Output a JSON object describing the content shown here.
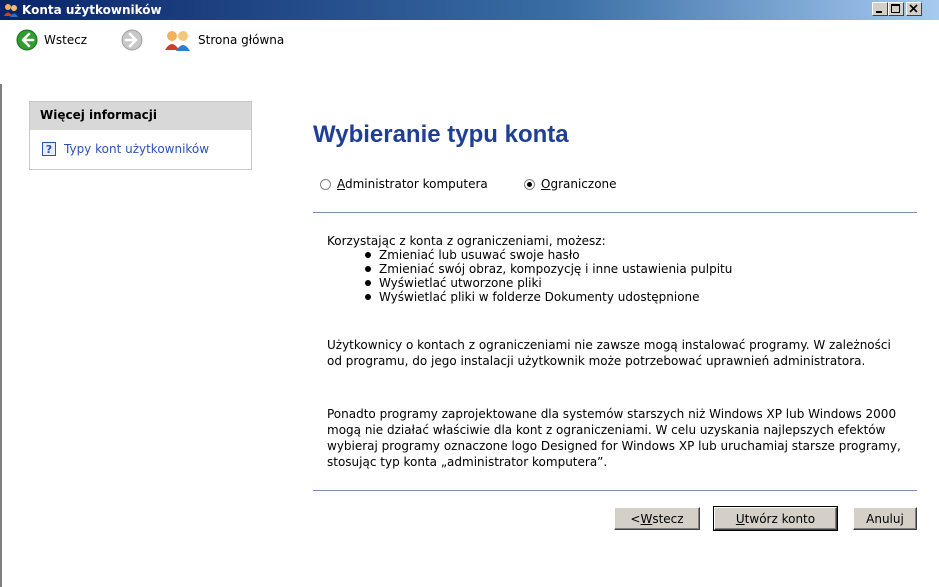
{
  "window": {
    "title": "Konta użytkowników",
    "icon": "users-icon"
  },
  "navbar": {
    "back_label": "Wstecz",
    "home_label": "Strona główna"
  },
  "sidebar": {
    "heading": "Więcej informacji",
    "link_label": "Typy kont użytkowników",
    "link_icon": "help-icon"
  },
  "main": {
    "title": "Wybieranie typu konta",
    "radio_options": [
      {
        "label_accel": "A",
        "label_rest": "dministrator komputera",
        "selected": false
      },
      {
        "label_accel": "O",
        "label_rest": "graniczone",
        "selected": true
      }
    ],
    "intro": "Korzystając z konta z ograniczeniami, możesz:",
    "bullets": [
      "Zmieniać lub usuwać swoje hasło",
      "Zmieniać swój obraz, kompozycję i inne ustawienia pulpitu",
      "Wyświetlać utworzone pliki",
      "Wyświetlać pliki w folderze Dokumenty udostępnione"
    ],
    "para2": "Użytkownicy o kontach z ograniczeniami nie zawsze mogą instalować programy. W zależności od programu, do jego instalacji użytkownik może potrzebować uprawnień administratora.",
    "para3": "Ponadto programy zaprojektowane dla systemów starszych niż Windows XP lub Windows 2000 mogą nie działać właściwie dla kont z ograniczeniami. W celu uzyskania najlepszych efektów wybieraj programy oznaczone logo Designed for Windows XP lub uruchamiaj starsze programy, stosując typ konta „administrator komputera”."
  },
  "buttons": {
    "back_prefix": "< ",
    "back_accel": "W",
    "back_rest": "stecz",
    "create_accel": "U",
    "create_rest": "twórz konto",
    "cancel": "Anuluj"
  },
  "colors": {
    "title_text": "#1e3f93",
    "link": "#2b52b7",
    "titlebar": "#0a246a"
  }
}
